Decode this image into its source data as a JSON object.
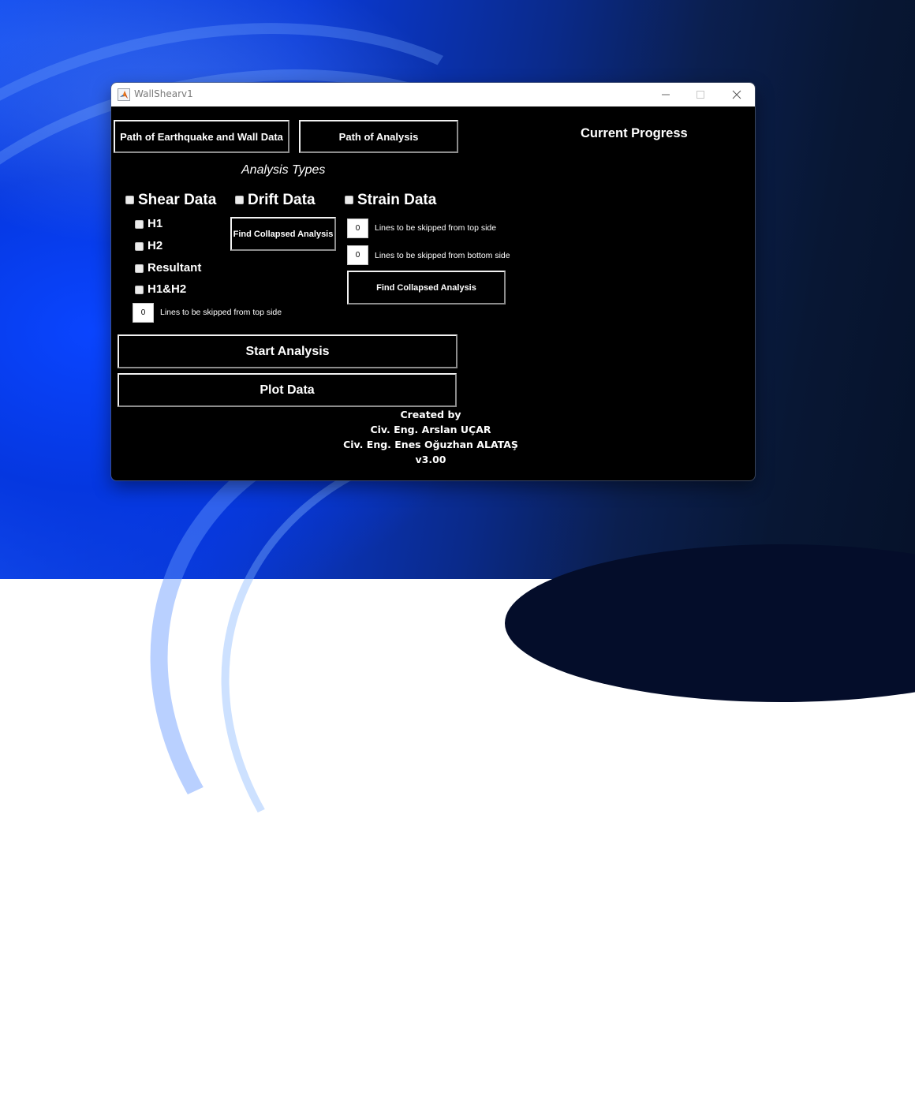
{
  "window": {
    "title": "WallShearv1",
    "app_icon": "matlab-icon",
    "controls": [
      "minimize-icon",
      "maximize-icon",
      "close-icon"
    ]
  },
  "top_buttons": {
    "path_earthquake": "Path of Earthquake and Wall Data",
    "path_analysis": "Path of Analysis"
  },
  "progress": {
    "title": "Current Progress"
  },
  "analysis_types": {
    "heading": "Analysis Types",
    "shear": {
      "label": "Shear Data",
      "checked": false,
      "options": [
        {
          "label": "H1",
          "checked": false
        },
        {
          "label": "H2",
          "checked": false
        },
        {
          "label": "Resultant",
          "checked": false
        },
        {
          "label": "H1&H2",
          "checked": false
        }
      ],
      "skip_top": {
        "value": "0",
        "label": "Lines to be skipped from top side"
      }
    },
    "drift": {
      "label": "Drift Data",
      "checked": false,
      "find_button": "Find Collapsed Analysis"
    },
    "strain": {
      "label": "Strain Data",
      "checked": false,
      "skip_top": {
        "value": "0",
        "label": "Lines to be skipped from top side"
      },
      "skip_bottom": {
        "value": "0",
        "label": "Lines to be skipped from bottom side"
      },
      "find_button": "Find Collapsed Analysis"
    }
  },
  "actions": {
    "start": "Start Analysis",
    "plot": "Plot Data"
  },
  "credits": {
    "line1": "Created by",
    "line2": "Civ. Eng. Arslan UÇAR",
    "line3": "Civ. Eng. Enes Oğuzhan ALATAŞ",
    "version": "v3.00"
  }
}
